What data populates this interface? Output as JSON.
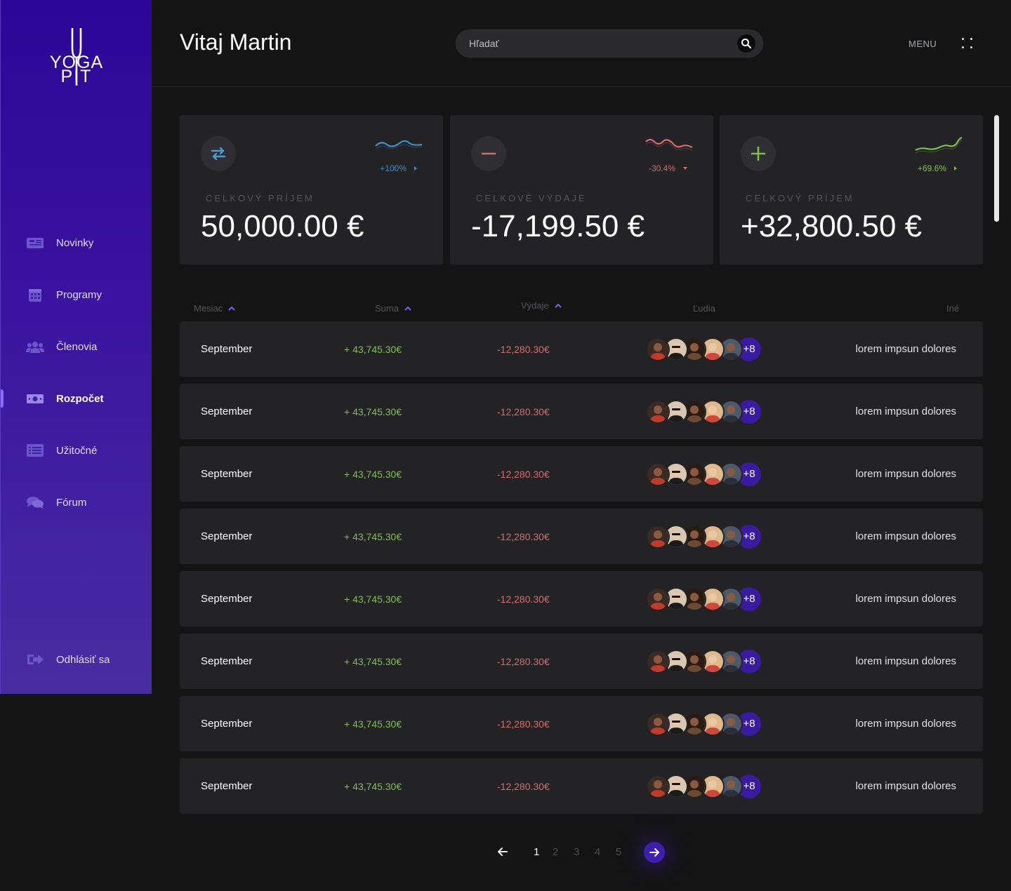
{
  "brand": {
    "logo_line1": "YOGA",
    "logo_line2": "PIT"
  },
  "sidebar": {
    "items": [
      {
        "label": "Novinky",
        "icon": "newspaper-icon"
      },
      {
        "label": "Programy",
        "icon": "calendar-icon"
      },
      {
        "label": "Členovia",
        "icon": "users-icon"
      },
      {
        "label": "Rozpočet",
        "icon": "money-icon",
        "active": true
      },
      {
        "label": "Užitočné",
        "icon": "list-icon"
      },
      {
        "label": "Fórum",
        "icon": "comments-icon"
      }
    ],
    "logout_label": "Odhlásiť sa"
  },
  "header": {
    "greeting": "Vitaj Martin",
    "search_placeholder": "Hľadať",
    "menu_label": "MENU"
  },
  "cards": [
    {
      "label": "CELKOVÝ PRÍJEM",
      "value": "50,000.00 €",
      "trend": "+100%",
      "trend_color": "#3f8fcf",
      "icon": "transfer-icon"
    },
    {
      "label": "CELKOVÉ VÝDAJE",
      "value": "-17,199.50 €",
      "trend": "-30.4%",
      "trend_color": "#d46c6c",
      "icon": "minus-icon"
    },
    {
      "label": "CELKOVÝ PRÍJEM",
      "value": "+32,800.50 €",
      "trend": "+69.6%",
      "trend_color": "#7fbf4d",
      "icon": "plus-icon"
    }
  ],
  "table": {
    "columns": [
      "Mesiac",
      "Suma",
      "Výdaje",
      "Ľudia",
      "Iné"
    ],
    "rows": [
      {
        "month": "September",
        "sum": "+ 43,745.30€",
        "expenses": "-12,280.30€",
        "more": "+8",
        "other": "lorem impsun dolores"
      },
      {
        "month": "September",
        "sum": "+ 43,745.30€",
        "expenses": "-12,280.30€",
        "more": "+8",
        "other": "lorem impsun dolores"
      },
      {
        "month": "September",
        "sum": "+ 43,745.30€",
        "expenses": "-12,280.30€",
        "more": "+8",
        "other": "lorem impsun dolores"
      },
      {
        "month": "September",
        "sum": "+ 43,745.30€",
        "expenses": "-12,280.30€",
        "more": "+8",
        "other": "lorem impsun dolores"
      },
      {
        "month": "September",
        "sum": "+ 43,745.30€",
        "expenses": "-12,280.30€",
        "more": "+8",
        "other": "lorem impsun dolores"
      },
      {
        "month": "September",
        "sum": "+ 43,745.30€",
        "expenses": "-12,280.30€",
        "more": "+8",
        "other": "lorem impsun dolores"
      },
      {
        "month": "September",
        "sum": "+ 43,745.30€",
        "expenses": "-12,280.30€",
        "more": "+8",
        "other": "lorem impsun dolores"
      },
      {
        "month": "September",
        "sum": "+ 43,745.30€",
        "expenses": "-12,280.30€",
        "more": "+8",
        "other": "lorem impsun dolores"
      }
    ]
  },
  "pagination": {
    "pages": [
      "1",
      "2",
      "3",
      "4",
      "5"
    ],
    "current": "1"
  },
  "colors": {
    "accent": "#3d1fb0",
    "positive": "#7fbf4d",
    "negative": "#d46c6c",
    "card_bg": "#232326"
  }
}
